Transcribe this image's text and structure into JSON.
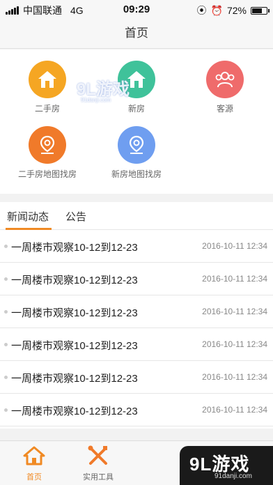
{
  "status_bar": {
    "carrier": "中国联通",
    "network": "4G",
    "time": "09:29",
    "battery_percent": "72%",
    "battery_level": 0.72
  },
  "nav": {
    "title": "首页"
  },
  "grid": {
    "items": [
      {
        "label": "二手房",
        "icon": "house-icon",
        "color": "#f5a623"
      },
      {
        "label": "新房",
        "icon": "house-icon",
        "color": "#3fc29a"
      },
      {
        "label": "客源",
        "icon": "people-icon",
        "color": "#ef6b6b"
      },
      {
        "label": "二手房地图找房",
        "icon": "map-pin-icon",
        "color": "#f07a2a"
      },
      {
        "label": "新房地图找房",
        "icon": "map-pin-icon",
        "color": "#6f9ef0"
      }
    ]
  },
  "watermark": {
    "text": "9L游戏",
    "sub": "91danji.com"
  },
  "news": {
    "tabs": [
      {
        "label": "新闻动态",
        "active": true
      },
      {
        "label": "公告",
        "active": false
      }
    ],
    "rows": [
      {
        "title": "一周楼市观察10-12到12-23",
        "date": "2016-10-11 12:34"
      },
      {
        "title": "一周楼市观察10-12到12-23",
        "date": "2016-10-11 12:34"
      },
      {
        "title": "一周楼市观察10-12到12-23",
        "date": "2016-10-11 12:34"
      },
      {
        "title": "一周楼市观察10-12到12-23",
        "date": "2016-10-11 12:34"
      },
      {
        "title": "一周楼市观察10-12到12-23",
        "date": "2016-10-11 12:34"
      },
      {
        "title": "一周楼市观察10-12到12-23",
        "date": "2016-10-11 12:34"
      }
    ]
  },
  "tabbar": {
    "items": [
      {
        "label": "首页",
        "icon": "house-icon",
        "active": true
      },
      {
        "label": "实用工具",
        "icon": "tools-icon",
        "active": false
      }
    ]
  },
  "colors": {
    "accent": "#f08a24"
  }
}
